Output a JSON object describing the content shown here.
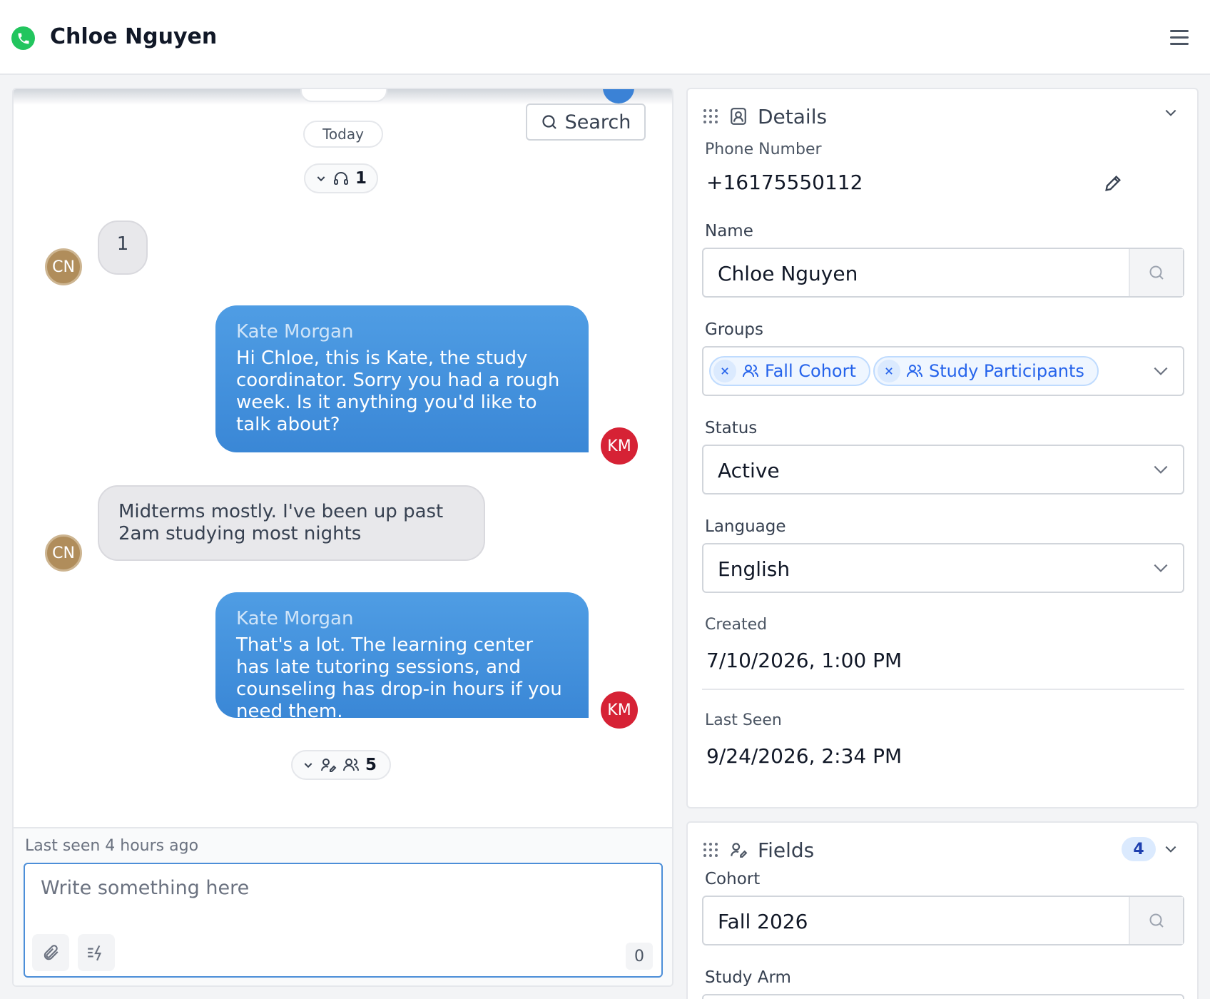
{
  "header": {
    "contact_name": "Chloe Nguyen",
    "phone_icon": "phone-icon",
    "menu_icon": "hamburger-menu-icon"
  },
  "chat": {
    "search_label": "Search",
    "date_pill": "Today",
    "event_pill_1": {
      "count": "1",
      "icon": "headset-icon"
    },
    "event_pill_2": {
      "count": "5",
      "icons": [
        "user-edit-icon",
        "users-icon"
      ]
    },
    "messages": [
      {
        "direction": "incoming",
        "avatar": "CN",
        "text": "1"
      },
      {
        "direction": "outgoing",
        "avatar": "KM",
        "sender": "Kate Morgan",
        "text": "Hi Chloe, this is Kate, the study coordinator. Sorry you had a rough week. Is it anything you'd like to talk about?"
      },
      {
        "direction": "incoming",
        "avatar": "CN",
        "text": "Midterms mostly. I've been up past 2am studying most nights"
      },
      {
        "direction": "outgoing",
        "avatar": "KM",
        "sender": "Kate Morgan",
        "text": "That's a lot. The learning center has late tutoring sessions, and counseling has drop-in hours if you need them."
      }
    ],
    "last_seen": "Last seen 4 hours ago",
    "composer": {
      "placeholder": "Write something here",
      "char_count": "0"
    },
    "colors": {
      "outgoing_bubble": "#3a87d6",
      "km_avatar": "#d62235",
      "cn_avatar": "#b08d5b"
    }
  },
  "details": {
    "title": "Details",
    "phone_label": "Phone Number",
    "phone_value": "+16175550112",
    "name_label": "Name",
    "name_value": "Chloe Nguyen",
    "groups_label": "Groups",
    "groups": [
      "Fall Cohort",
      "Study Participants"
    ],
    "status_label": "Status",
    "status_value": "Active",
    "language_label": "Language",
    "language_value": "English",
    "created_label": "Created",
    "created_value": "7/10/2026, 1:00 PM",
    "last_seen_label": "Last Seen",
    "last_seen_value": "9/24/2026, 2:34 PM"
  },
  "fields": {
    "title": "Fields",
    "count": "4",
    "cohort_label": "Cohort",
    "cohort_value": "Fall 2026",
    "study_arm_label": "Study Arm"
  }
}
